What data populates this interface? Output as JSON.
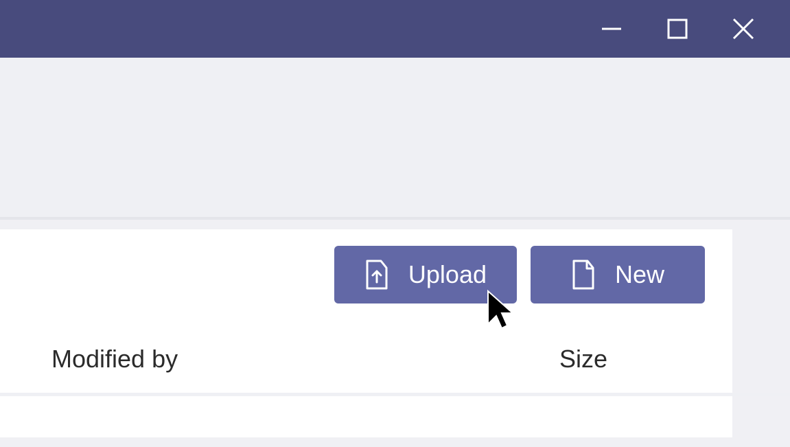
{
  "window_controls": {
    "minimize": "minimize",
    "maximize": "maximize",
    "close": "close"
  },
  "toolbar": {
    "upload_label": "Upload",
    "new_label": "New"
  },
  "columns": {
    "modified_by": "Modified by",
    "size": "Size"
  }
}
